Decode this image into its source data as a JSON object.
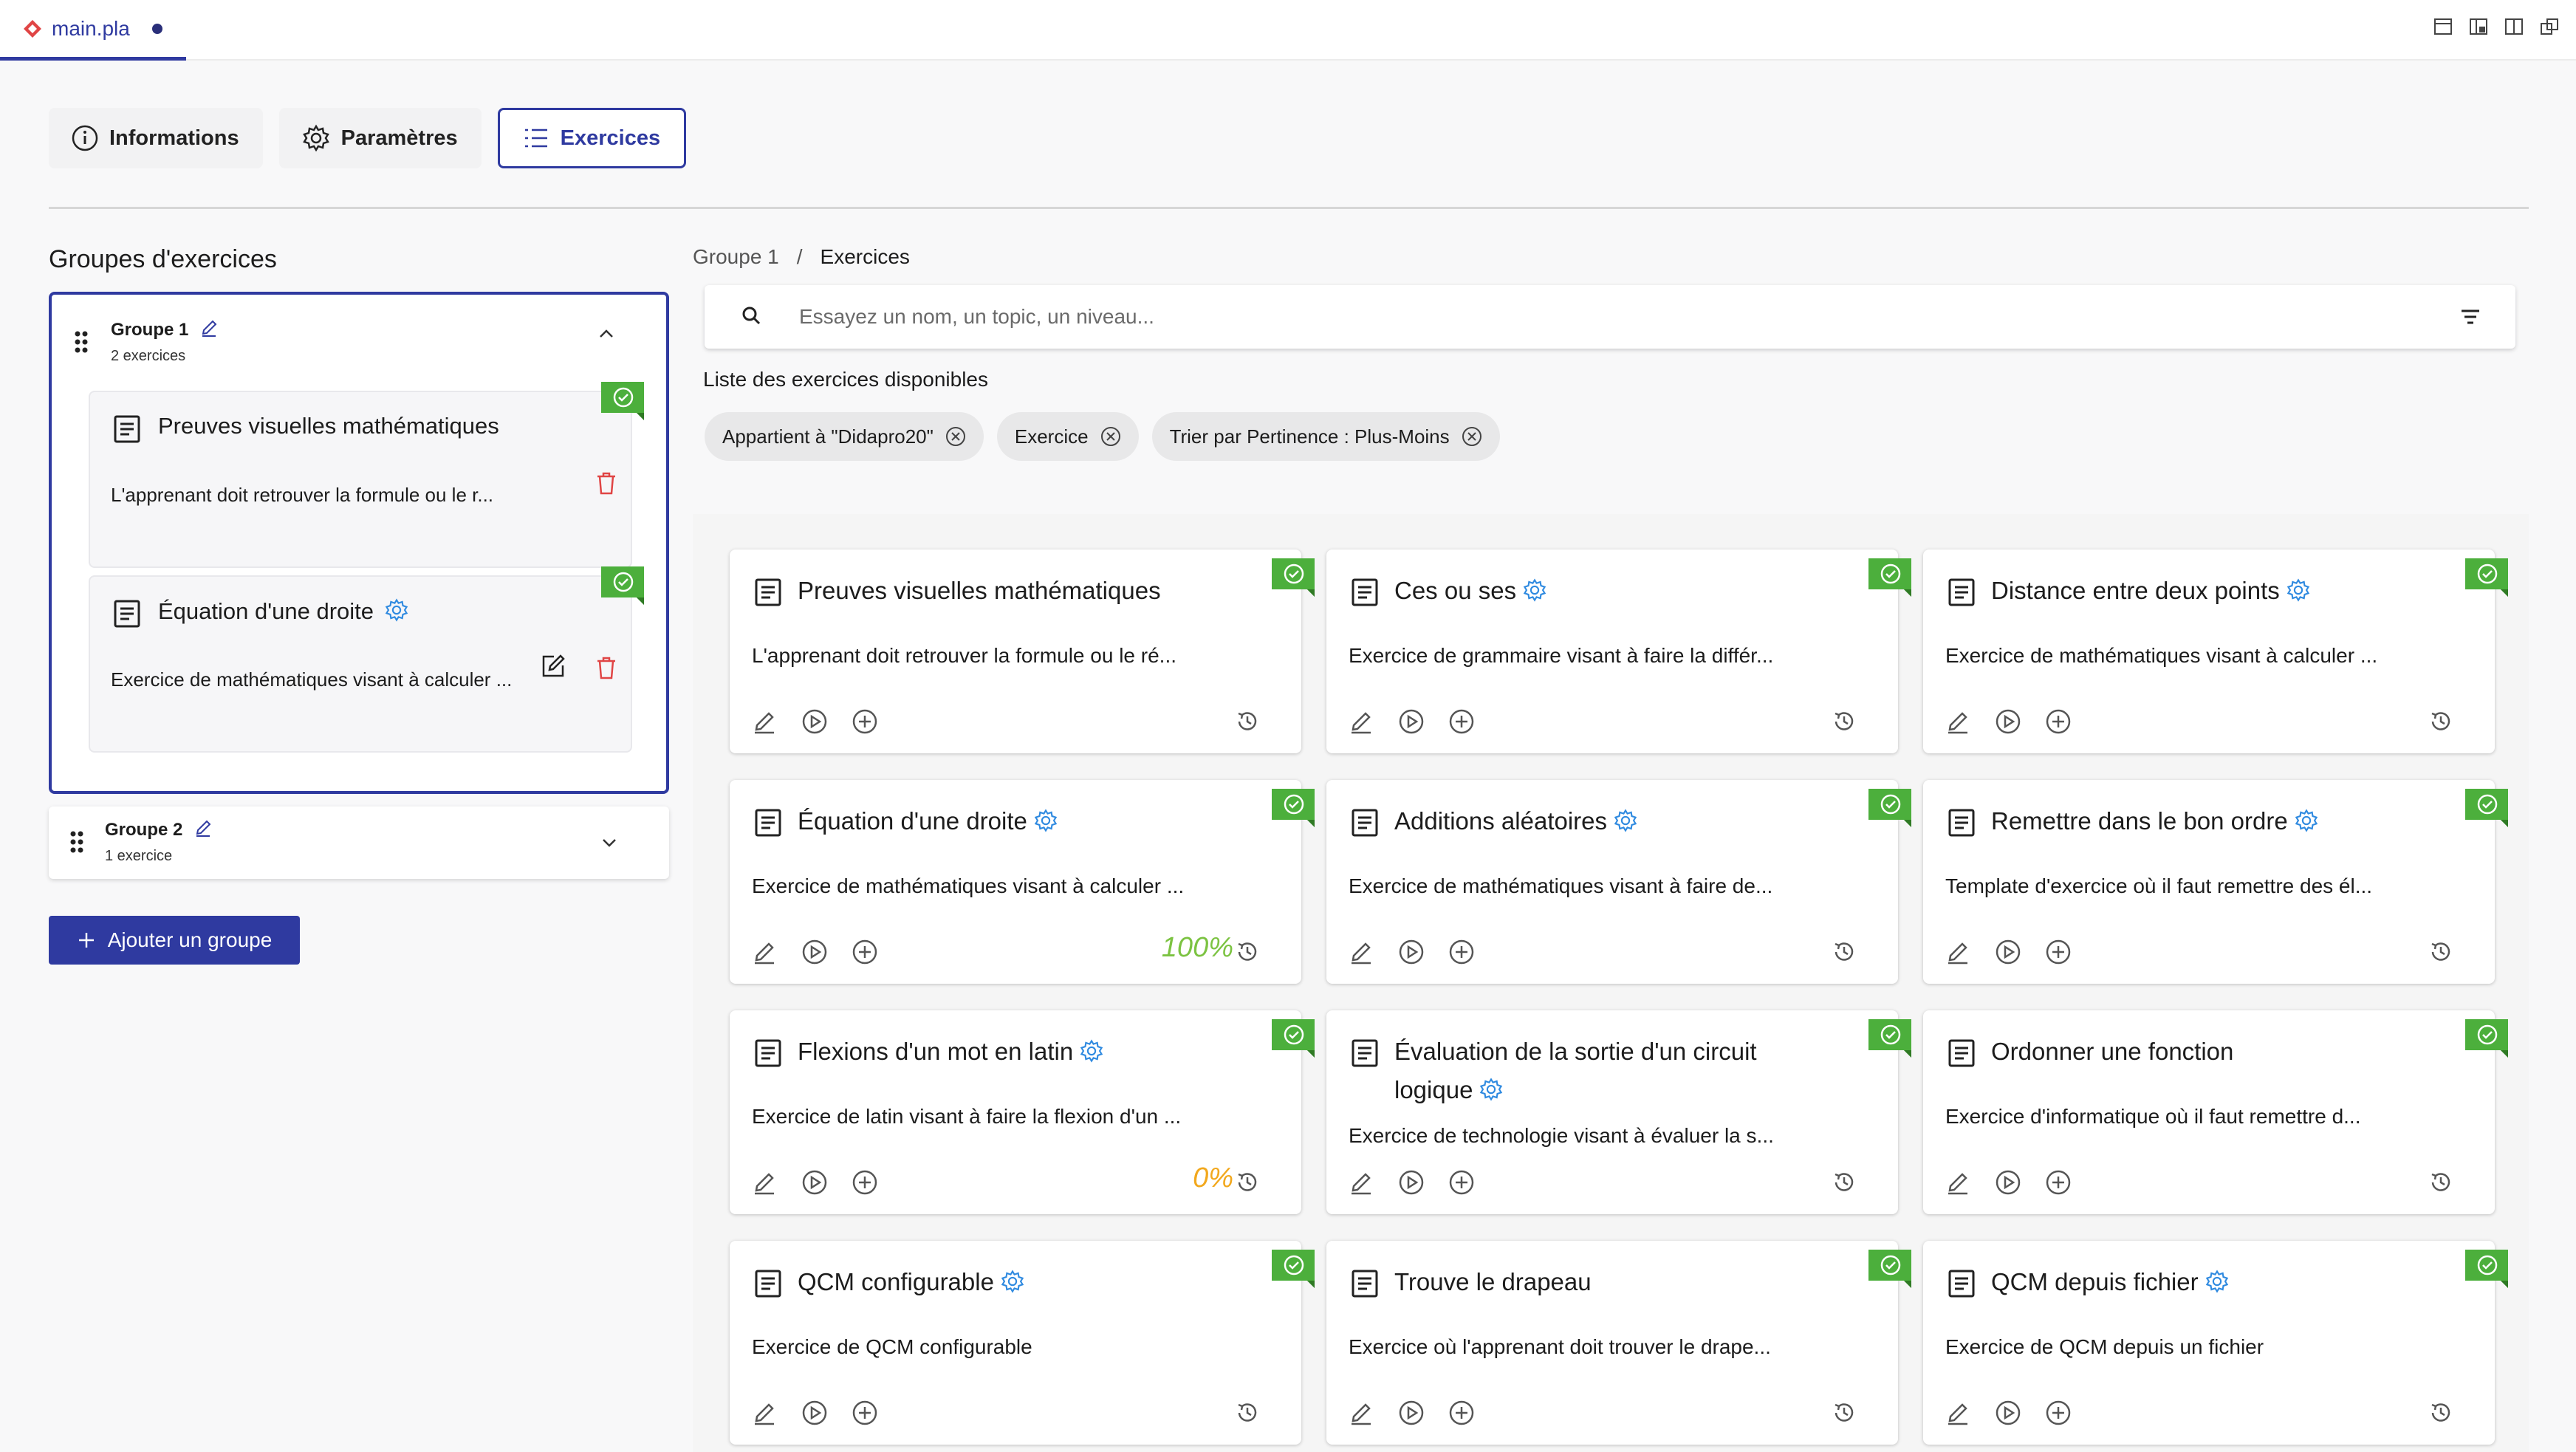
{
  "file_tab": {
    "name": "main.pla"
  },
  "main_tabs": [
    {
      "label": "Informations"
    },
    {
      "label": "Paramètres"
    },
    {
      "label": "Exercices"
    }
  ],
  "groups_panel": {
    "title": "Groupes d'exercices",
    "groups": [
      {
        "title": "Groupe 1",
        "subtitle": "2 exercices",
        "expanded": true,
        "items": [
          {
            "title": "Preuves visuelles mathématiques",
            "desc": "L'apprenant doit retrouver la formule ou le r..."
          },
          {
            "title": "Équation d'une droite",
            "desc": "Exercice de mathématiques visant à calculer ..."
          }
        ]
      },
      {
        "title": "Groupe 2",
        "subtitle": "1 exercice",
        "expanded": false
      }
    ],
    "add_button": "Ajouter un groupe"
  },
  "breadcrumb": {
    "first": "Groupe 1",
    "separator": "/",
    "current": "Exercices"
  },
  "search": {
    "placeholder": "Essayez un nom, un topic, un niveau..."
  },
  "list_label": "Liste des exercices disponibles",
  "chips": [
    {
      "label": "Appartient à \"Didapro20\""
    },
    {
      "label": "Exercice"
    },
    {
      "label": "Trier par Pertinence : Plus-Moins"
    }
  ],
  "cards": [
    {
      "title": "Preuves visuelles mathématiques",
      "gear": false,
      "desc": "L'apprenant doit retrouver la formule ou le ré...",
      "score": ""
    },
    {
      "title": "Ces ou ses",
      "gear": true,
      "desc": "Exercice de grammaire visant à faire la différ...",
      "score": ""
    },
    {
      "title": "Distance entre deux points",
      "gear": true,
      "desc": "Exercice de mathématiques visant à calculer ...",
      "score": ""
    },
    {
      "title": "Équation d'une droite",
      "gear": true,
      "desc": "Exercice de mathématiques visant à calculer ...",
      "score": "100%"
    },
    {
      "title": "Additions aléatoires",
      "gear": true,
      "desc": "Exercice de mathématiques visant à faire de...",
      "score": ""
    },
    {
      "title": "Remettre dans le bon ordre",
      "gear": true,
      "desc": "Template d'exercice où il faut remettre des él...",
      "score": ""
    },
    {
      "title": "Flexions d'un mot en latin",
      "gear": true,
      "desc": "Exercice de latin visant à faire la flexion d'un ...",
      "score": "0%"
    },
    {
      "title": "Évaluation de la sortie d'un circuit logique",
      "gear": true,
      "desc": "Exercice de technologie visant à évaluer la s...",
      "score": ""
    },
    {
      "title": "Ordonner une fonction",
      "gear": false,
      "desc": "Exercice d'informatique où il faut remettre d...",
      "score": ""
    },
    {
      "title": "QCM configurable",
      "gear": true,
      "desc": "Exercice de QCM configurable",
      "score": ""
    },
    {
      "title": "Trouve le drapeau",
      "gear": false,
      "desc": "Exercice où l'apprenant doit trouver le drape...",
      "score": ""
    },
    {
      "title": "QCM depuis fichier",
      "gear": true,
      "desc": "Exercice de QCM depuis un fichier",
      "score": ""
    }
  ],
  "colors": {
    "accent": "#2f3aa0",
    "badge_green": "#4caf3c",
    "gear_blue": "#2f8ae0",
    "trash_red": "#e04545",
    "score_success": "#7cc342",
    "score_warning": "#f2a81d"
  },
  "icons": [
    "info-icon",
    "gear-icon",
    "list-icon",
    "drag-handle-icon",
    "pencil-icon",
    "chevron-up-icon",
    "chevron-down-icon",
    "document-icon",
    "check-badge-icon",
    "trash-icon",
    "edit-square-icon",
    "plus-icon",
    "search-icon",
    "filter-icon",
    "close-circle-icon",
    "play-icon",
    "add-circle-icon",
    "history-icon"
  ]
}
